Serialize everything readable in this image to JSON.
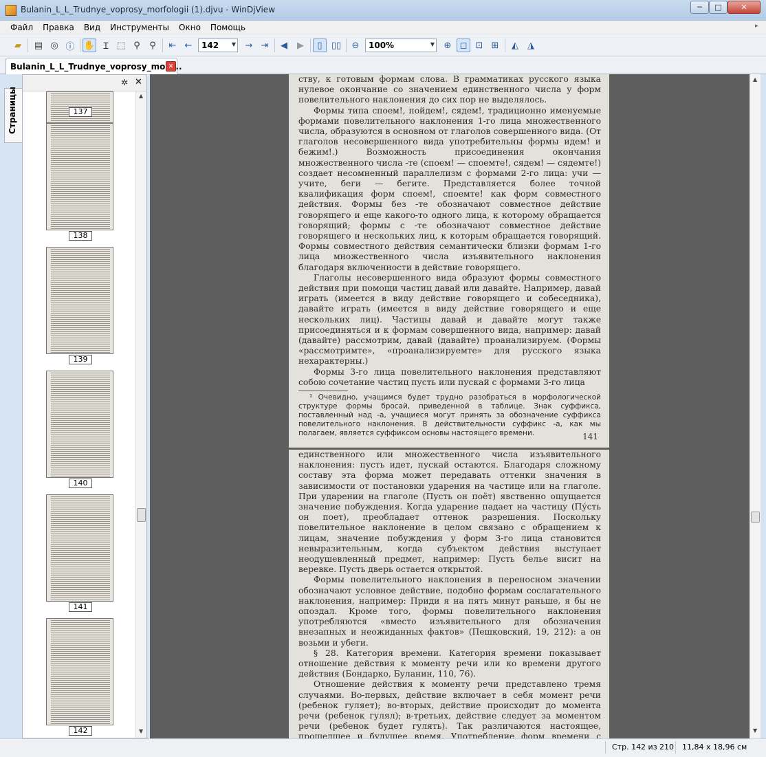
{
  "window": {
    "title": "Bulanin_L_L_Trudnye_voprosy_morfologii (1).djvu - WinDjView",
    "min_glyph": "─",
    "max_glyph": "□",
    "close_glyph": "✕"
  },
  "menu": [
    "Файл",
    "Правка",
    "Вид",
    "Инструменты",
    "Окно",
    "Помощь"
  ],
  "toolbar": {
    "page_number": "142",
    "zoom": "100%"
  },
  "tab": {
    "label": "Bulanin_L_L_Trudnye_voprosy_morf...",
    "close_glyph": "✕"
  },
  "sidebar": {
    "tab_label": "Страницы",
    "thumbnails": [
      "137",
      "138",
      "139",
      "140",
      "141",
      "142"
    ],
    "close_glyph": "✕",
    "gear_glyph": "✲"
  },
  "page1": {
    "lines_top": "ству, к готовым формам слова. В грамматиках русского языка нулевое окончание со значением единственного числа у форм повелительного наклонения до сих пор не выделялось.",
    "para1": "Формы типа споем!, пойдем!, сядем!, традиционно именуемые формами повелительного наклонения 1-го лица множественного числа, образуются в основном от глаголов совершенного вида. (От глаголов несовершенного вида употребительны формы идем! и бежим!.) Возможность присоединения окончания множественного числа -те (споем! — споемте!, сядем! — сядемте!) создает несомненный параллелизм с формами 2-го лица: учи — учите, беги — бегите. Представляется более точной квалификация форм споем!, споемте! как форм совместного действия. Формы без -те обозначают совместное действие говорящего и еще какого-то одного лица, к которому обращается говорящий; формы с -те обозначают совместное действие говорящего и нескольких лиц, к которым обращается говорящий. Формы совместного действия семантически близки формам 1-го лица множественного числа изъявительного наклонения благодаря включенности в действие говорящего.",
    "para2": "Глаголы несовершенного вида образуют формы совместного действия при помощи частиц давай или давайте. Например, давай играть (имеется в виду действие говорящего и собеседника), давайте играть (имеется в виду действие говорящего и еще нескольких лиц). Частицы давай и давайте могут также присоединяться и к формам совершенного вида, например: давай (давайте) рассмотрим, давай (давайте) проанализируем. (Формы «рассмотримте», «проанализируемте» для русского языка нехарактерны.)",
    "para3": "Формы 3-го лица повелительного наклонения представляют собою сочетание частиц пусть или пускай с формами 3-го лица",
    "footnote": "¹ Очевидно, учащимся будет трудно разобраться в морфологической структуре формы бросай, приведенной в таблице. Знак суффикса, поставленный над -а, учащиеся могут принять за обозначение суффикса повелительного наклонения. В действительности суффикс -а, как мы полагаем, является суффиксом основы настоящего времени.",
    "page_number": "141"
  },
  "page2": {
    "para1": "единственного или множественного числа изъявительного наклонения: пусть идет, пускай остаются. Благодаря сложному составу эта форма может передавать оттенки значения в зависимости от постановки ударения на частице или на глаголе. При ударении на глаголе (Пусть он поёт) явственно ощущается значение побуждения. Когда ударение падает на частицу (Пу́сть он поет), преобладает оттенок разрешения. Поскольку повелительное наклонение в целом связано с обращением к лицам, значение побуждения у форм 3-го лица становится невыразительным, когда субъектом действия выступает неодушевленный предмет, например: Пусть белье висит на веревке. Пусть дверь остается открытой.",
    "para2": "Формы повелительного наклонения в переносном значении обозначают условное действие, подобно формам сослагательного наклонения, например: Приди я на пять минут раньше, я бы не опоздал. Кроме того, формы повелительного наклонения употребляются «вместо изъявительного для обозначения внезапных и неожиданных фактов» (Пешковский, 19, 212): а он возьми и убеги.",
    "para3": "§ 28. Категория времени. Категория времени показывает отношение действия к моменту речи или ко времени другого действия (Бондарко, Буланин, 110, 76).",
    "para4": "Отношение действия к моменту речи представлено тремя случаями. Во-первых, действие включает в себя момент речи (ребенок гуляет); во-вторых, действие происходит до момента речи (ребенок гулял); в-третьих, действие следует за моментом речи (ребенок будет гулять). Так различаются настоящее, прошедшее и будущее время. Употребление форм времени с точки зре-"
  },
  "status": {
    "page_info": "Стр. 142 из 210",
    "page_size": "11,84 x 18,96 см"
  }
}
